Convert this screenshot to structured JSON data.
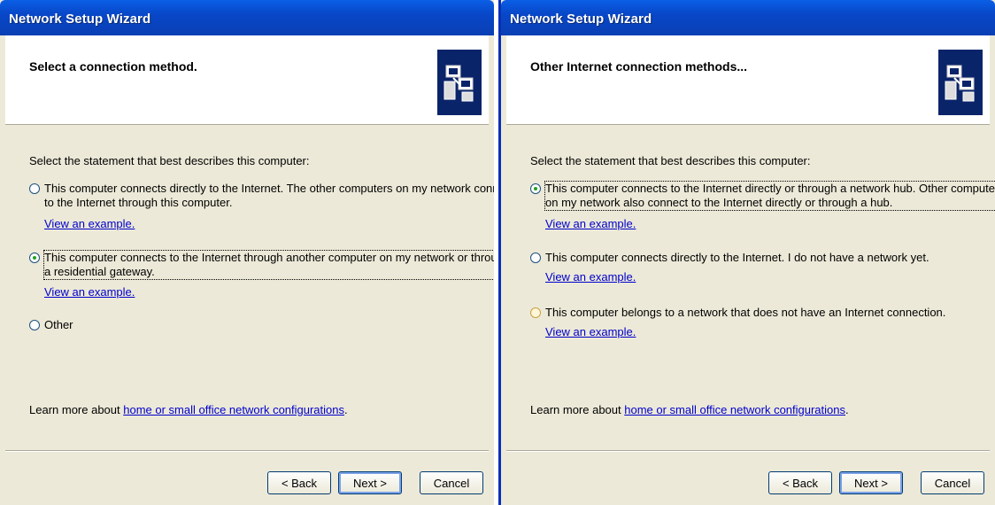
{
  "left": {
    "title": "Network Setup Wizard",
    "header": "Select a connection method.",
    "prompt": "Select the statement that best describes this computer:",
    "option1": {
      "line1": "This computer connects directly to the Internet. The other computers on my network connect",
      "line2": "to the Internet through this computer.",
      "link": "View an example."
    },
    "option2": {
      "line1": "This computer connects to the Internet through another computer on my network or through",
      "line2": "a residential gateway.",
      "link": "View an example."
    },
    "option3": {
      "label": "Other"
    },
    "learn_prefix": "Learn more about ",
    "learn_link": "home or small office network configurations",
    "learn_suffix": ".",
    "buttons": {
      "back": "< Back",
      "next": "Next >",
      "cancel": "Cancel"
    }
  },
  "right": {
    "title": "Network Setup Wizard",
    "header": "Other Internet connection methods...",
    "prompt": "Select the statement that best describes this computer:",
    "option1": {
      "line1": "This computer connects to the Internet directly or through a network hub. Other computers",
      "line2": "on my network also connect to the Internet directly or through a hub.",
      "link": "View an example."
    },
    "option2": {
      "line1": "This computer connects directly to the Internet. I do not have a network yet.",
      "link": "View an example."
    },
    "option3": {
      "line1": "This computer belongs to a network that does not have an Internet connection.",
      "link": "View an example."
    },
    "learn_prefix": "Learn more about ",
    "learn_link": "home or small office network configurations",
    "learn_suffix": ".",
    "buttons": {
      "back": "< Back",
      "next": "Next >",
      "cancel": "Cancel"
    }
  },
  "icons": {
    "wizard": "network-computers-icon"
  },
  "colors": {
    "titlebar": "#0a47c8",
    "panel": "#ece9d8",
    "link": "#0000cc",
    "radio_checked": "#21a121"
  }
}
